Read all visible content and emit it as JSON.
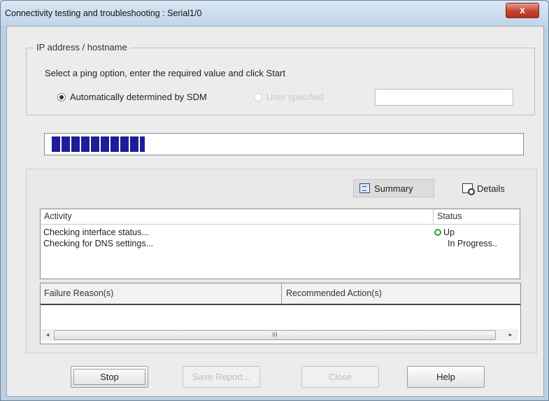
{
  "window": {
    "title": "Connectivity testing and troubleshooting : Serial1/0",
    "close_label": "x"
  },
  "ip_group": {
    "legend": "IP address / hostname",
    "instruction": "Select a ping option, enter the required value and click Start",
    "option_auto": "Automatically determined by SDM",
    "option_user": "User specified",
    "user_value": ""
  },
  "progress": {
    "fraction": 0.2
  },
  "views": {
    "summary": "Summary",
    "details": "Details"
  },
  "activity": {
    "header_activity": "Activity",
    "header_status": "Status",
    "rows": [
      {
        "activity": "Checking interface status...",
        "status": "Up"
      },
      {
        "activity": "Checking for DNS settings...",
        "status": "In Progress.."
      }
    ]
  },
  "failure": {
    "header_failure": "Failure Reason(s)",
    "header_action": "Recommended Action(s)",
    "scroll_grip": "III"
  },
  "buttons": {
    "stop": "Stop",
    "save": "Save Report...",
    "close": "Close",
    "help": "Help"
  }
}
